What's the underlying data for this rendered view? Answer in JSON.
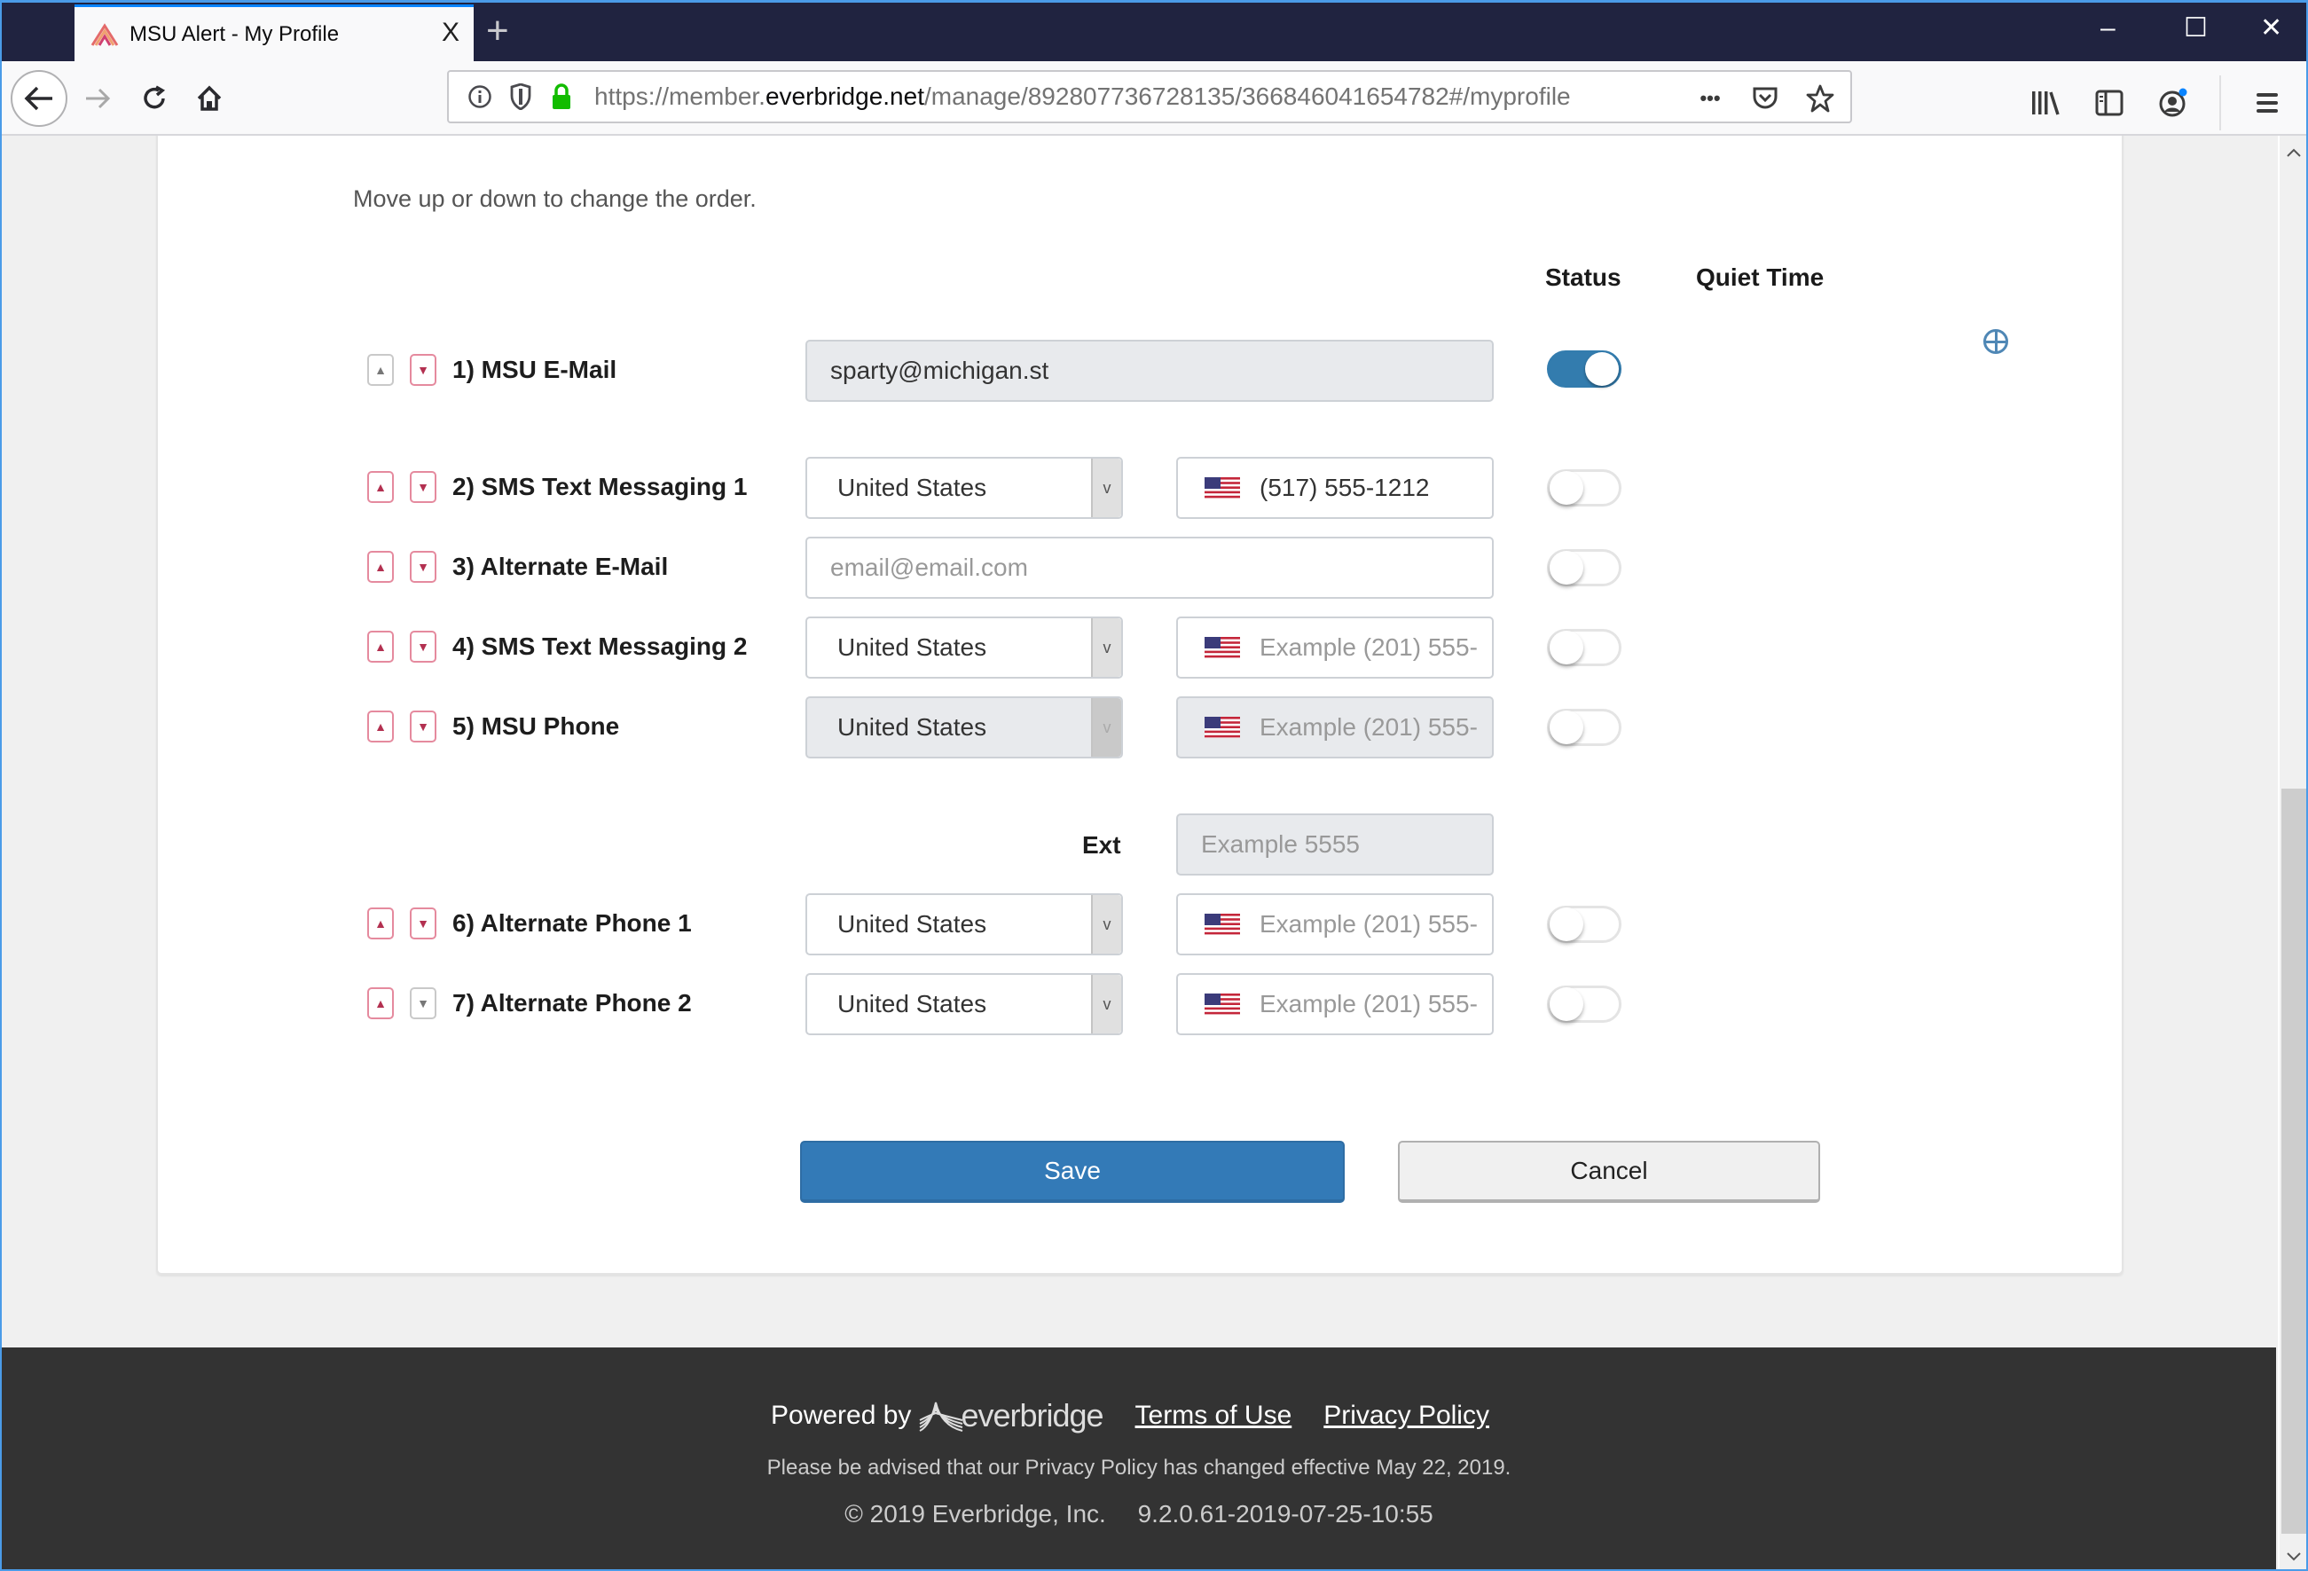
{
  "browser": {
    "tab_title": "MSU Alert - My Profile",
    "tab_close": "X",
    "new_tab": "+",
    "window_controls": {
      "minimize": "–",
      "maximize": "☐",
      "close": "✕"
    },
    "url_prefix": "https://member.",
    "url_domain": "everbridge.net",
    "url_path": "/manage/892807736728135/366846041654782#/myprofile",
    "url_more": "•••"
  },
  "page": {
    "hint": "Move up or down to change the order.",
    "columns": {
      "status": "Status",
      "quiet_time": "Quiet Time"
    },
    "rows": [
      {
        "label": "1) MSU E-Mail",
        "type": "email",
        "value": "sparty@michigan.st",
        "readonly": true,
        "status_on": true,
        "up_enabled": false,
        "down_enabled": true
      },
      {
        "label": "2) SMS Text Messaging 1",
        "type": "phone",
        "country": "United States",
        "phone": "(517) 555-1212",
        "status_on": false,
        "up_enabled": true,
        "down_enabled": true
      },
      {
        "label": "3) Alternate E-Mail",
        "type": "email",
        "placeholder": "email@email.com",
        "status_on": false,
        "up_enabled": true,
        "down_enabled": true
      },
      {
        "label": "4) SMS Text Messaging 2",
        "type": "phone",
        "country": "United States",
        "phone_placeholder": "Example (201) 555-",
        "status_on": false,
        "up_enabled": true,
        "down_enabled": true
      },
      {
        "label": "5) MSU Phone",
        "type": "phone",
        "country": "United States",
        "phone_placeholder": "Example (201) 555-",
        "readonly": true,
        "status_on": false,
        "up_enabled": true,
        "down_enabled": true,
        "ext_label": "Ext",
        "ext_placeholder": "Example 5555"
      },
      {
        "label": "6) Alternate Phone 1",
        "type": "phone",
        "country": "United States",
        "phone_placeholder": "Example (201) 555-",
        "status_on": false,
        "up_enabled": true,
        "down_enabled": true
      },
      {
        "label": "7) Alternate Phone 2",
        "type": "phone",
        "country": "United States",
        "phone_placeholder": "Example (201) 555-",
        "status_on": false,
        "up_enabled": true,
        "down_enabled": false
      }
    ],
    "save_label": "Save",
    "cancel_label": "Cancel"
  },
  "footer": {
    "powered_by": "Powered by",
    "logo_text": "everbridge",
    "terms": "Terms of Use",
    "privacy": "Privacy Policy",
    "notice": "Please be advised that our Privacy Policy has changed effective May 22, 2019.",
    "copyright": "©  2019 Everbridge, Inc.",
    "version": "9.2.0.61-2019-07-25-10:55"
  },
  "colors": {
    "accent": "#337ab7",
    "toggle_on": "#337cae",
    "arrow_border": "#e58a9e",
    "footer_bg": "#333333"
  }
}
